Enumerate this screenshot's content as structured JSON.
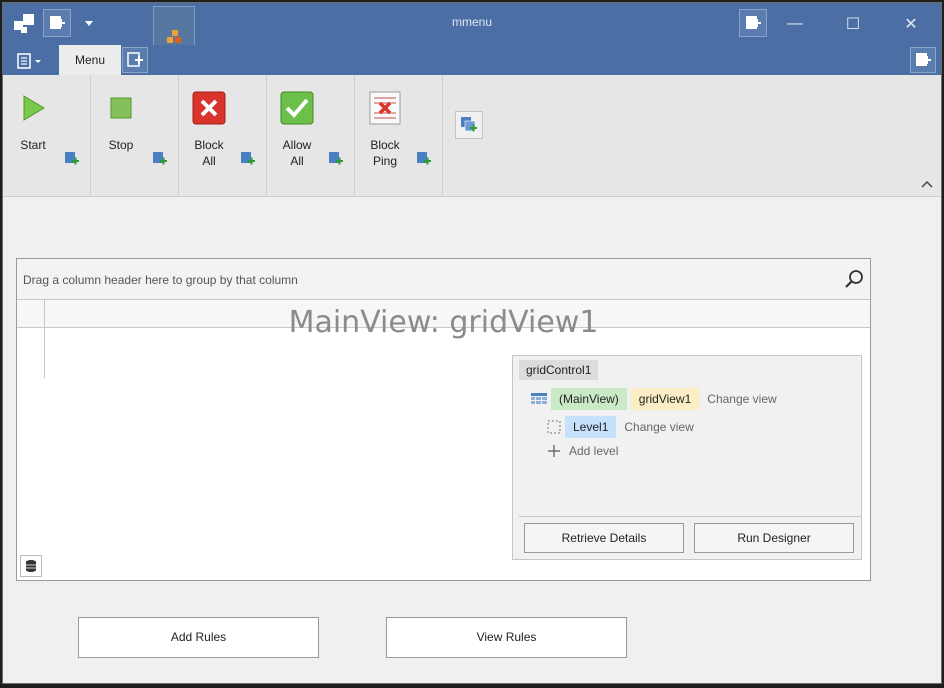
{
  "window": {
    "title": "mmenu"
  },
  "titlebar": {
    "controls": {
      "minimize": "—",
      "maximize": "☐",
      "close": "✕"
    }
  },
  "tabs": [
    {
      "label": "Menu"
    }
  ],
  "ribbon": {
    "buttons": [
      {
        "label_line1": "Start",
        "label_line2": "",
        "icon": "play-icon"
      },
      {
        "label_line1": "Stop",
        "label_line2": "",
        "icon": "stop-icon"
      },
      {
        "label_line1": "Block",
        "label_line2": "All",
        "icon": "block-all-icon"
      },
      {
        "label_line1": "Allow",
        "label_line2": "All",
        "icon": "allow-all-icon"
      },
      {
        "label_line1": "Block",
        "label_line2": "Ping",
        "icon": "block-ping-icon"
      }
    ]
  },
  "grid": {
    "group_panel_text": "Drag a column header here to group by that column",
    "view_caption": "MainView: gridView1"
  },
  "designer": {
    "control_name": "gridControl1",
    "main_view_label": "(MainView)",
    "main_view_name": "gridView1",
    "change_view_1": "Change view",
    "level_name": "Level1",
    "change_view_2": "Change view",
    "add_level": "Add level",
    "retrieve_details": "Retrieve Details",
    "run_designer": "Run Designer"
  },
  "actions": {
    "add_rules": "Add Rules",
    "view_rules": "View Rules"
  },
  "colors": {
    "titlebar": "#4b6fa5",
    "chip_green": "#c9e9c7",
    "chip_yellow": "#fbeec4",
    "chip_blue": "#c5e1fb"
  }
}
